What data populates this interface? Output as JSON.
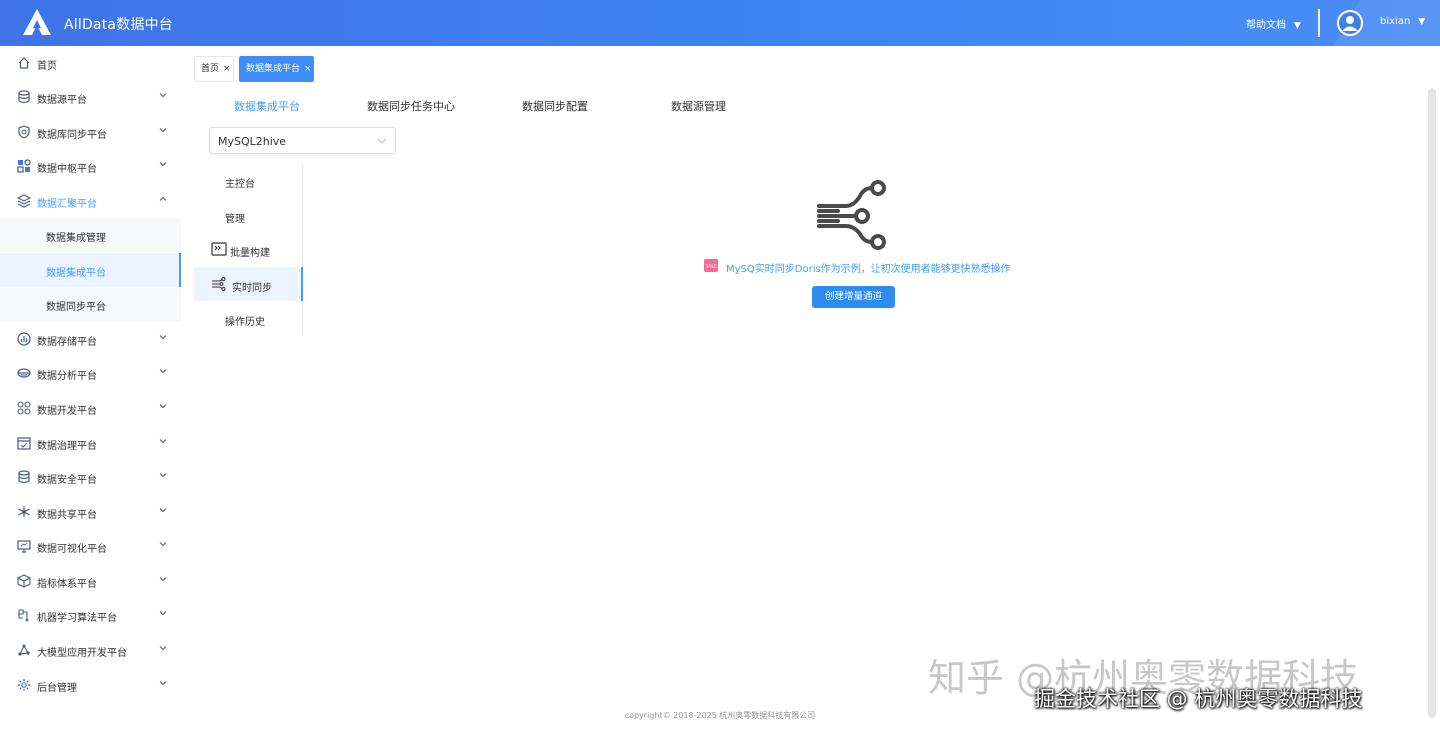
{
  "header": {
    "app_title": "AllData数据中台",
    "help_label": "帮助文档",
    "username": "bixian",
    "caret": "▼"
  },
  "sidebar": {
    "items": [
      {
        "label": "首页",
        "icon": "home-icon",
        "expandable": false
      },
      {
        "label": "数据源平台",
        "icon": "database-icon",
        "expandable": true
      },
      {
        "label": "数据库同步平台",
        "icon": "shield-icon",
        "expandable": true
      },
      {
        "label": "数据中枢平台",
        "icon": "grid-icon",
        "expandable": true
      },
      {
        "label": "数据汇聚平台",
        "icon": "layers-icon",
        "expandable": true,
        "open": true,
        "children": [
          {
            "label": "数据集成管理"
          },
          {
            "label": "数据集成平台",
            "active": true
          },
          {
            "label": "数据同步平台"
          }
        ]
      },
      {
        "label": "数据存储平台",
        "icon": "chart-icon",
        "expandable": true
      },
      {
        "label": "数据分析平台",
        "icon": "analysis-icon",
        "expandable": true
      },
      {
        "label": "数据开发平台",
        "icon": "apps-icon",
        "expandable": true
      },
      {
        "label": "数据治理平台",
        "icon": "calendar-icon",
        "expandable": true
      },
      {
        "label": "数据安全平台",
        "icon": "cylinder-icon",
        "expandable": true
      },
      {
        "label": "数据共享平台",
        "icon": "network-icon",
        "expandable": true
      },
      {
        "label": "数据可视化平台",
        "icon": "monitor-icon",
        "expandable": true
      },
      {
        "label": "指标体系平台",
        "icon": "cube-icon",
        "expandable": true
      },
      {
        "label": "机器学习算法平台",
        "icon": "ml-icon",
        "expandable": true
      },
      {
        "label": "大模型应用开发平台",
        "icon": "graph-icon",
        "expandable": true
      },
      {
        "label": "后台管理",
        "icon": "settings-icon",
        "expandable": true
      }
    ]
  },
  "tags": [
    {
      "label": "首页",
      "active": false
    },
    {
      "label": "数据集成平台",
      "active": true
    }
  ],
  "tag_close": "×",
  "tabs": [
    {
      "label": "数据集成平台",
      "active": true
    },
    {
      "label": "数据同步任务中心",
      "active": false
    },
    {
      "label": "数据同步配置",
      "active": false
    },
    {
      "label": "数据源管理",
      "active": false
    }
  ],
  "project_select": {
    "value": "MySQL2hive"
  },
  "side_menu": [
    {
      "label": "主控台",
      "icon": null,
      "active": false
    },
    {
      "label": "管理",
      "icon": null,
      "active": false
    },
    {
      "label": "批量构建",
      "icon": "terminal-icon",
      "active": false
    },
    {
      "label": "实时同步",
      "icon": "flow-icon",
      "active": true
    },
    {
      "label": "操作历史",
      "icon": null,
      "active": false
    }
  ],
  "empty_state": {
    "message": "MySQ实时同步Doris作为示例，让初次使用者能够更快熟悉操作",
    "button_label": "创建增量通道",
    "tip_icon_text": "SALE"
  },
  "footer": {
    "copyright": "copyright© 2018-2025 杭州奥零数据科技有限公司"
  },
  "watermarks": {
    "line1": "知乎 @杭州奥零数据科技",
    "line2": "掘金技术社区 @ 杭州奥零数据科技"
  },
  "colors": {
    "primary": "#409eff",
    "header": "#3f73e6",
    "button": "#2d8cf0"
  }
}
